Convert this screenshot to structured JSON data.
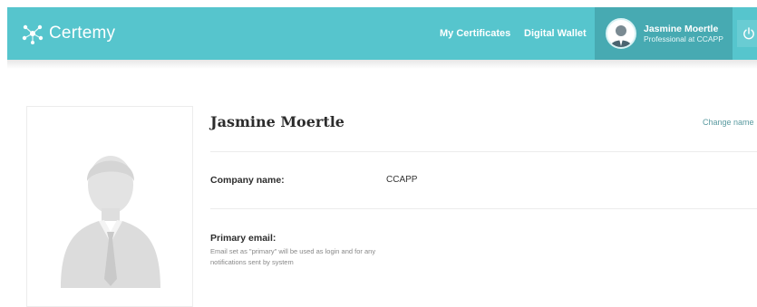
{
  "header": {
    "brand_name": "Certemy",
    "nav": {
      "my_certificates": "My Certificates",
      "digital_wallet": "Digital Wallet"
    },
    "user": {
      "name": "Jasmine Moertle",
      "role": "Professional at CCAPP"
    },
    "icons": {
      "logo": "network-nodes-icon",
      "power": "power-icon",
      "avatar": "user-avatar-icon"
    }
  },
  "profile": {
    "name": "Jasmine Moertle",
    "change_name_link": "Change name",
    "company_label": "Company name:",
    "company_value": "CCAPP",
    "email_label": "Primary email:",
    "email_help": "Email set as \"primary\" will be used as login and for any notifications sent by system"
  },
  "colors": {
    "header_bg": "#56c5cd",
    "user_box_bg": "#47aab2",
    "accent_link": "#5a9aa0"
  }
}
